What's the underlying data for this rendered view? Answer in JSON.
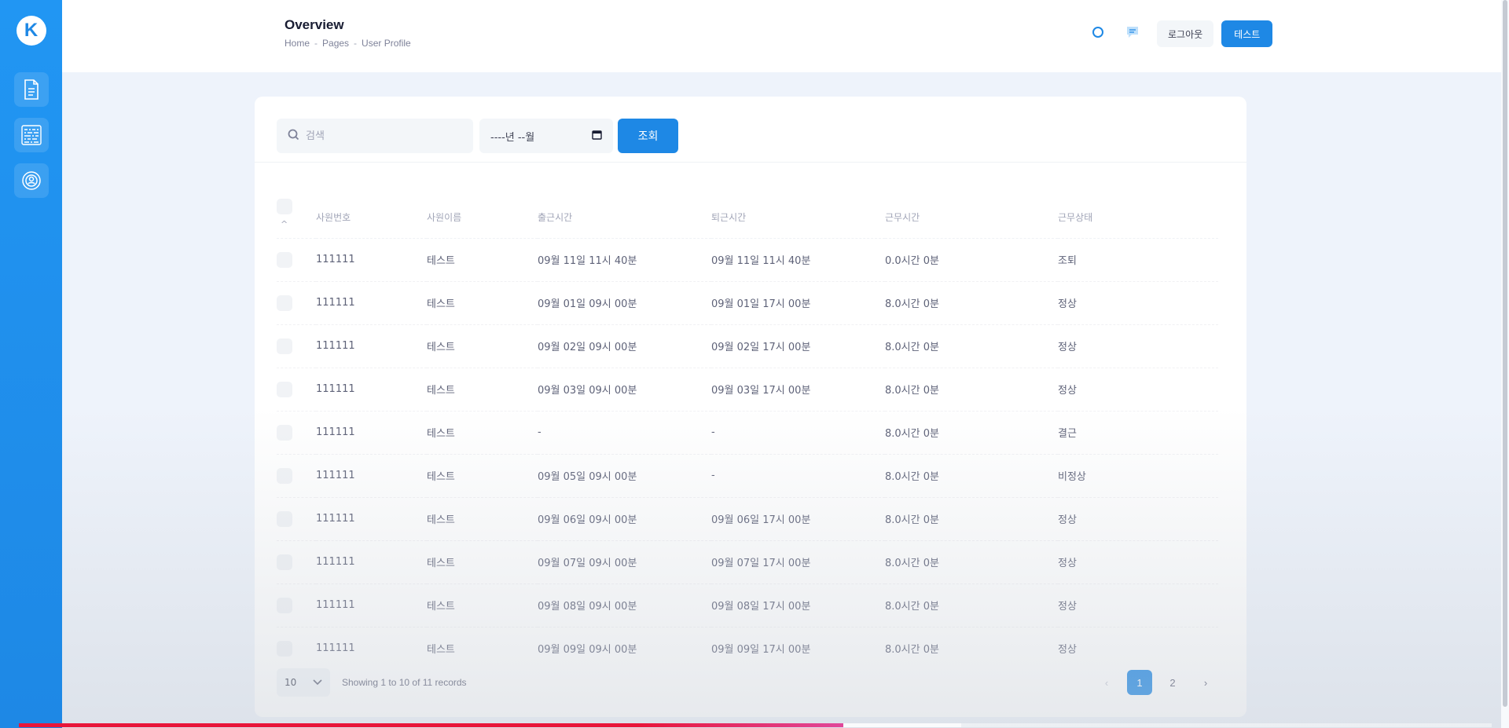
{
  "sidebar": {
    "logo": "K",
    "items": [
      {
        "icon": "document-icon"
      },
      {
        "icon": "qr-code-icon"
      },
      {
        "icon": "user-settings-icon"
      }
    ]
  },
  "header": {
    "title": "Overview",
    "breadcrumb": [
      "Home",
      "Pages",
      "User Profile"
    ],
    "breadcrumb_sep": "-",
    "logout_label": "로그아웃",
    "user_label": "테스트"
  },
  "toolbar": {
    "search_placeholder": "검색",
    "month_value": "----년 --월",
    "search_button": "조회"
  },
  "table": {
    "columns": [
      "사원번호",
      "사원이름",
      "출근시간",
      "퇴근시간",
      "근무시간",
      "근무상태"
    ],
    "rows": [
      [
        "111111",
        "테스트",
        "09월 11일 11시 40분",
        "09월 11일 11시 40분",
        "0.0시간 0분",
        "조퇴"
      ],
      [
        "111111",
        "테스트",
        "09월 01일 09시 00분",
        "09월 01일 17시 00분",
        "8.0시간 0분",
        "정상"
      ],
      [
        "111111",
        "테스트",
        "09월 02일 09시 00분",
        "09월 02일 17시 00분",
        "8.0시간 0분",
        "정상"
      ],
      [
        "111111",
        "테스트",
        "09월 03일 09시 00분",
        "09월 03일 17시 00분",
        "8.0시간 0분",
        "정상"
      ],
      [
        "111111",
        "테스트",
        "-",
        "-",
        "8.0시간 0분",
        "결근"
      ],
      [
        "111111",
        "테스트",
        "09월 05일 09시 00분",
        "-",
        "8.0시간 0분",
        "비정상"
      ],
      [
        "111111",
        "테스트",
        "09월 06일 09시 00분",
        "09월 06일 17시 00분",
        "8.0시간 0분",
        "정상"
      ],
      [
        "111111",
        "테스트",
        "09월 07일 09시 00분",
        "09월 07일 17시 00분",
        "8.0시간 0분",
        "정상"
      ],
      [
        "111111",
        "테스트",
        "09월 08일 09시 00분",
        "09월 08일 17시 00분",
        "8.0시간 0분",
        "정상"
      ],
      [
        "111111",
        "테스트",
        "09월 09일 09시 00분",
        "09월 09일 17시 00분",
        "8.0시간 0분",
        "정상"
      ]
    ]
  },
  "footer": {
    "page_size": "10",
    "showing": "Showing 1 to 10 of 11 records",
    "pages": [
      "1",
      "2"
    ],
    "current_page": "1",
    "prev": "‹",
    "next": "›"
  },
  "colors": {
    "accent": "#1e88e5",
    "progress": "#e8163a"
  },
  "video_progress": {
    "played_fraction": 0.56,
    "buffered_fraction": 0.08
  }
}
